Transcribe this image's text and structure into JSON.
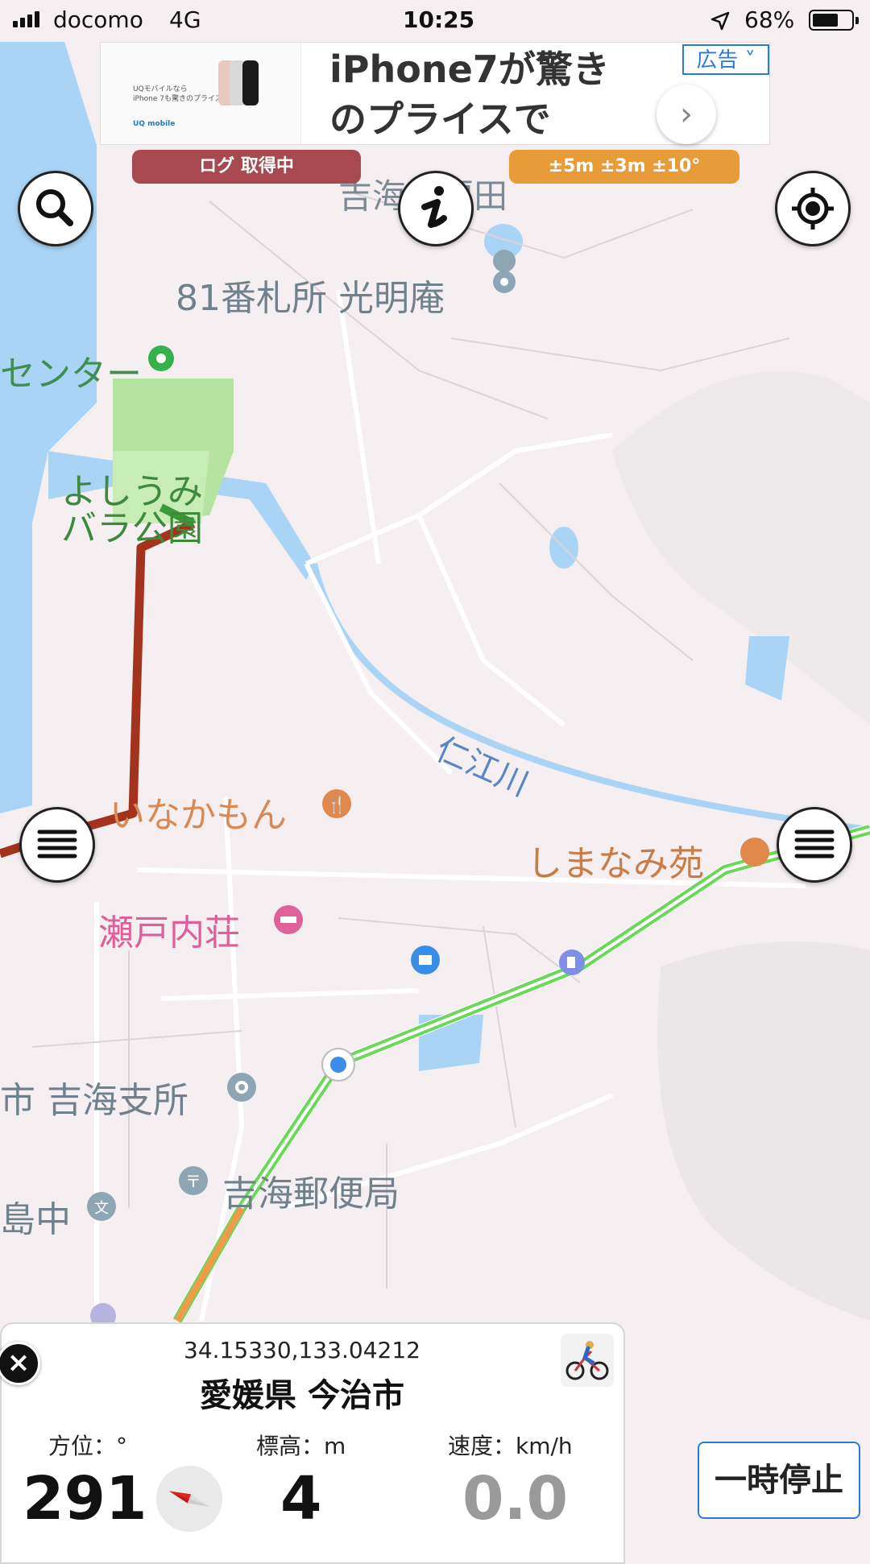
{
  "status_bar": {
    "carrier": "docomo",
    "network": "4G",
    "time": "10:25",
    "battery": "68%",
    "battery_level": 0.68
  },
  "ad": {
    "headline_line1": "iPhone7が驚き",
    "headline_line2": "のプライスで",
    "badge": "広告 ˅",
    "image_text_line1": "UQモバイルなら",
    "image_text_line2": "iPhone 7も驚きのプライス",
    "image_brand": "UQ mobile"
  },
  "log_status": "ログ 取得中",
  "accuracy": "±5m ±3m ±10°",
  "map": {
    "labels": {
      "yoshiumi_fukuda": "吉海町福田",
      "temple": "81番札所 光明庵",
      "center": "センター",
      "park_line1": "よしうみ",
      "park_line2": "バラ公園",
      "river": "仁江川",
      "inakamon": "いなかもん",
      "shimanamien": "しまなみ苑",
      "setouchiso": "瀬戸内荘",
      "branch_office": "市 吉海支所",
      "post_office": "吉海郵便局",
      "school": "島中"
    },
    "colors": {
      "water": "#a9d4f5",
      "park": "#b5e3a0",
      "route": "#a3331d",
      "expressway": "#6cd85a",
      "restaurant": "#e0894a",
      "hotel": "#e0609a",
      "poi_blue": "#3a8ee6",
      "poi_gray": "#7b8e99"
    }
  },
  "icons": {
    "search": "search-icon",
    "info": "info-icon",
    "locate": "locate-icon",
    "menu": "menu-icon",
    "close": "close-icon",
    "bicycle": "bicycle-icon",
    "compass": "compass-icon"
  },
  "panel": {
    "coordinates": "34.15330,133.04212",
    "place": "愛媛県 今治市",
    "bearing_label": "方位：°",
    "bearing_value": "291",
    "altitude_label": "標高：m",
    "altitude_value": "4",
    "speed_label": "速度：km/h",
    "speed_value": "0.0",
    "pause_label": "一時停止"
  }
}
